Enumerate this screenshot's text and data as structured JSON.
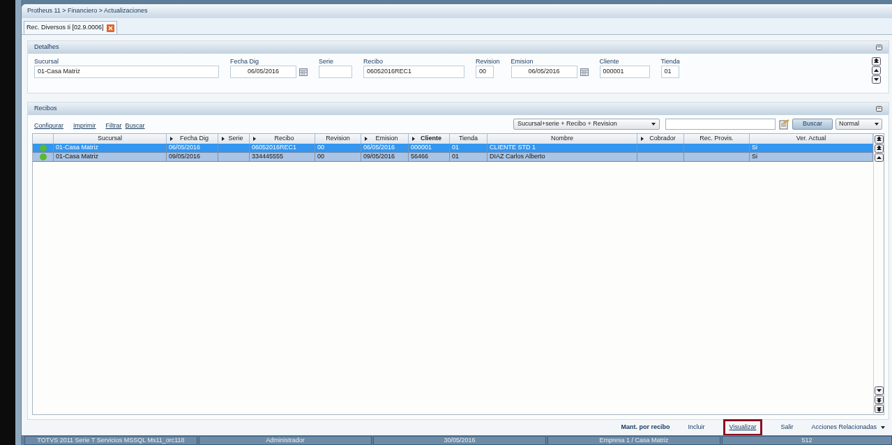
{
  "breadcrumb": "Protheus 11 > Financiero > Actualizaciones",
  "tabs": [
    {
      "label": "Rec. Diversos Ii [02.9.0006]",
      "selected": true
    }
  ],
  "details": {
    "title": "Detalhes",
    "fields": [
      {
        "label": "Sucursal",
        "value": "01-Casa Matriz",
        "kind": "text"
      },
      {
        "label": "Fecha Dig",
        "value": "06/05/2016",
        "kind": "date"
      },
      {
        "label": "Serie",
        "kind": "text"
      },
      {
        "label": "Recibo",
        "value": "06052016REC1",
        "kind": "text"
      },
      {
        "label": "Revision",
        "value": "00",
        "kind": "text"
      },
      {
        "label": "Emision",
        "value": "06/05/2016",
        "kind": "date"
      },
      {
        "label": "Cliente",
        "value": "000001",
        "kind": "text"
      },
      {
        "label": "Tienda",
        "value": "01",
        "kind": "text"
      }
    ]
  },
  "receipts": {
    "title": "Recibos",
    "links": [
      "Configurar",
      "Imprimir",
      "Filtrar",
      "Buscar"
    ],
    "index_select": "Sucursal+serie + Recibo + Revision",
    "search_button": "Buscar",
    "view_select": "Normal",
    "columns": [
      {
        "label": "Sucursal",
        "sortable": false,
        "bold": false
      },
      {
        "label": "Fecha Dig",
        "sortable": true,
        "bold": false
      },
      {
        "label": "Serie",
        "sortable": true,
        "bold": false
      },
      {
        "label": "Recibo",
        "sortable": true,
        "bold": false
      },
      {
        "label": "Revision",
        "sortable": false,
        "bold": false
      },
      {
        "label": "Emision",
        "sortable": true,
        "bold": false
      },
      {
        "label": "Cliente",
        "sortable": true,
        "bold": true
      },
      {
        "label": "Tienda",
        "sortable": false,
        "bold": false
      },
      {
        "label": "Nombre",
        "sortable": false,
        "bold": false
      },
      {
        "label": "Cobrador",
        "sortable": true,
        "bold": false
      },
      {
        "label": "Rec. Provis.",
        "sortable": false,
        "bold": false
      },
      {
        "label": "Ver. Actual",
        "sortable": false,
        "bold": false
      }
    ],
    "rows": [
      {
        "selected": true,
        "color": "#5cb82e",
        "cells": [
          "01-Casa Matriz",
          "06/05/2016",
          "",
          "06052016REC1",
          "00",
          "06/05/2016",
          "000001",
          "01",
          "CLIENTE STD 1",
          "",
          "",
          "Si"
        ]
      },
      {
        "selected": false,
        "color": "#5cb82e",
        "cells": [
          "01-Casa Matriz",
          "09/05/2016",
          "",
          "334445555",
          "00",
          "09/05/2016",
          "56466",
          "01",
          "DIAZ Carlos Alberto",
          "",
          "",
          "Si"
        ]
      }
    ]
  },
  "actions": [
    {
      "label": "Mant. por recibo",
      "bold": true,
      "highlighted": false
    },
    {
      "label": "Incluir",
      "bold": false,
      "highlighted": false
    },
    {
      "label": "Visualizar",
      "bold": false,
      "highlighted": true
    },
    {
      "label": "Salir",
      "bold": false,
      "highlighted": false
    },
    {
      "label": "Acciones Relacionadas",
      "bold": false,
      "highlighted": false,
      "menu": true
    }
  ],
  "status_bar": [
    "TOTVS 2011 Serie T Servicios MSSQL Ms11_orc118",
    "Administrador",
    "30/05/2016",
    "Empresa 1 / Casa Matriz",
    "512"
  ]
}
